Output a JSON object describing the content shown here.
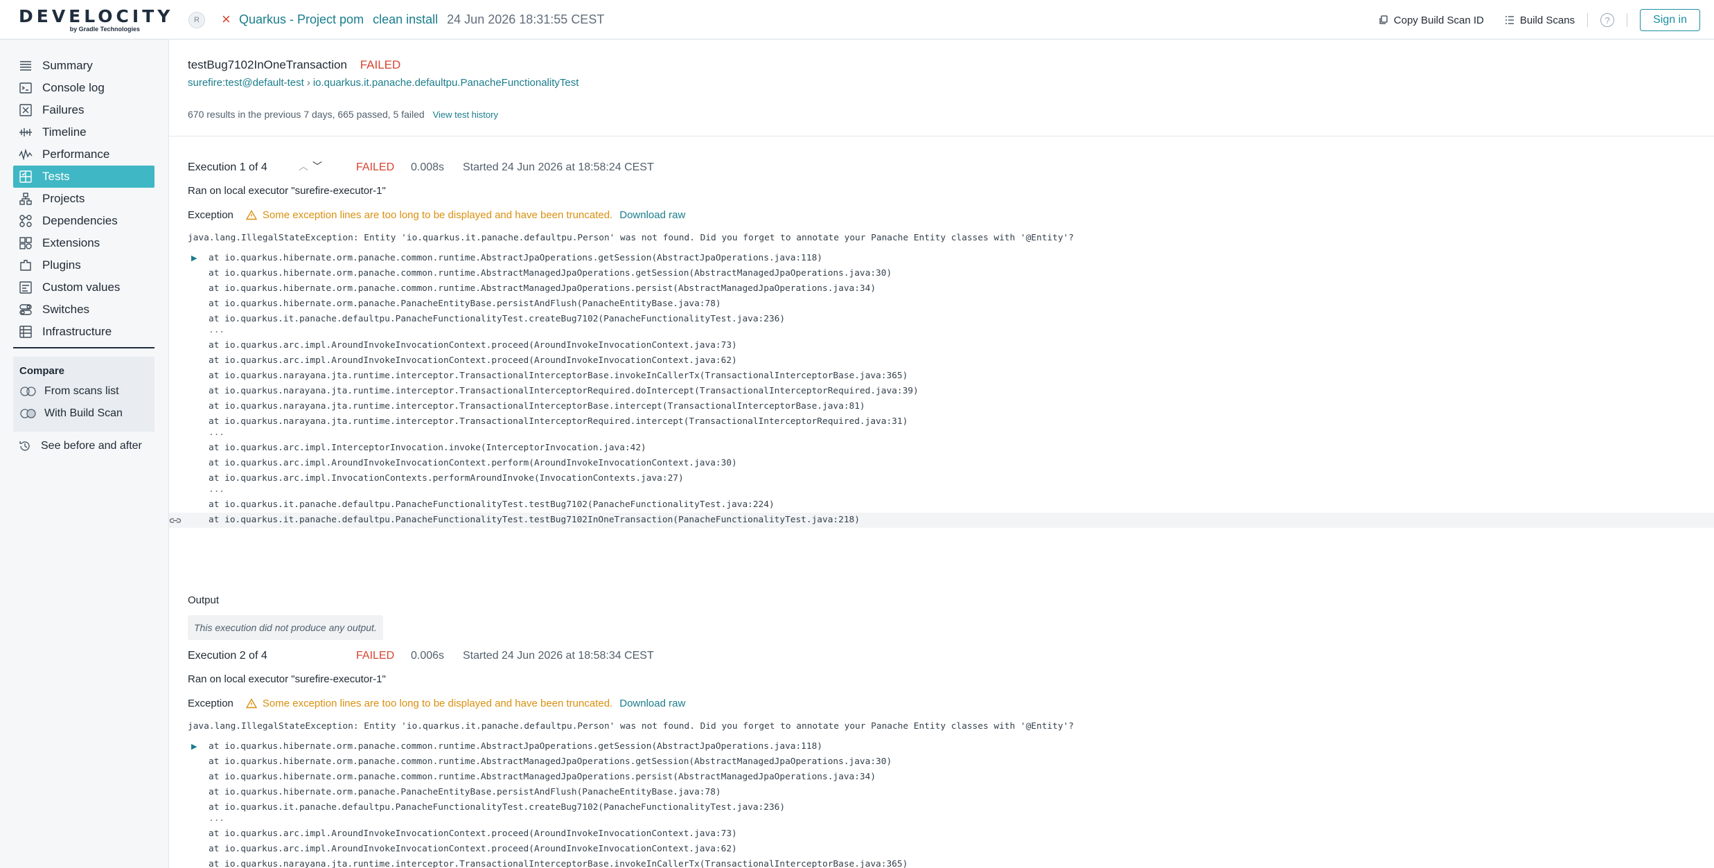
{
  "header": {
    "logo_word": "DEVELOCITY",
    "logo_sub": "by Gradle Technologies",
    "avatar_initial": "R",
    "status_mark": "×",
    "project": "Quarkus - Project pom",
    "task": "clean install",
    "date": "24 Jun 2026 18:31:55 CEST",
    "copy_id_label": "Copy Build Scan ID",
    "build_scans_label": "Build Scans",
    "help_label": "?",
    "signin_label": "Sign in"
  },
  "sidebar": {
    "items": [
      {
        "label": "Summary",
        "icon": "summary-icon"
      },
      {
        "label": "Console log",
        "icon": "console-icon"
      },
      {
        "label": "Failures",
        "icon": "failures-icon"
      },
      {
        "label": "Timeline",
        "icon": "timeline-icon"
      },
      {
        "label": "Performance",
        "icon": "performance-icon"
      },
      {
        "label": "Tests",
        "icon": "tests-icon",
        "active": true
      },
      {
        "label": "Projects",
        "icon": "projects-icon"
      },
      {
        "label": "Dependencies",
        "icon": "dependencies-icon"
      },
      {
        "label": "Extensions",
        "icon": "extensions-icon"
      },
      {
        "label": "Plugins",
        "icon": "plugins-icon"
      },
      {
        "label": "Custom values",
        "icon": "custom-values-icon"
      },
      {
        "label": "Switches",
        "icon": "switches-icon"
      },
      {
        "label": "Infrastructure",
        "icon": "infrastructure-icon"
      }
    ],
    "compare": {
      "title": "Compare",
      "from_scans": "From scans list",
      "with_scan": "With Build Scan"
    },
    "see_before_after": "See before and after"
  },
  "test": {
    "name": "testBug7102InOneTransaction",
    "status": "FAILED",
    "crumb_task": "surefire:test@default-test",
    "crumb_class": "io.quarkus.it.panache.defaultpu.PanacheFunctionalityTest",
    "results_summary": "670 results in the previous 7 days, 665 passed, 5 failed",
    "history_link": "View test history"
  },
  "executions": [
    {
      "title": "Execution 1 of 4",
      "status": "FAILED",
      "duration": "0.008s",
      "started": "Started 24 Jun 2026 at 18:58:24 CEST",
      "executor": "Ran on local executor \"surefire-executor-1\"",
      "exception_label": "Exception",
      "warning": "Some exception lines are too long to be displayed and have been truncated.",
      "download": "Download raw",
      "message": "java.lang.IllegalStateException: Entity 'io.quarkus.it.panache.defaultpu.Person' was not found. Did you forget to annotate your Panache Entity classes with '@Entity'?",
      "trace": [
        "at io.quarkus.hibernate.orm.panache.common.runtime.AbstractJpaOperations.getSession(AbstractJpaOperations.java:118)",
        "at io.quarkus.hibernate.orm.panache.common.runtime.AbstractManagedJpaOperations.getSession(AbstractManagedJpaOperations.java:30)",
        "at io.quarkus.hibernate.orm.panache.common.runtime.AbstractManagedJpaOperations.persist(AbstractManagedJpaOperations.java:34)",
        "at io.quarkus.hibernate.orm.panache.PanacheEntityBase.persistAndFlush(PanacheEntityBase.java:78)",
        "at io.quarkus.it.panache.defaultpu.PanacheFunctionalityTest.createBug7102(PanacheFunctionalityTest.java:236)",
        "...",
        "at io.quarkus.arc.impl.AroundInvokeInvocationContext.proceed(AroundInvokeInvocationContext.java:73)",
        "at io.quarkus.arc.impl.AroundInvokeInvocationContext.proceed(AroundInvokeInvocationContext.java:62)",
        "at io.quarkus.narayana.jta.runtime.interceptor.TransactionalInterceptorBase.invokeInCallerTx(TransactionalInterceptorBase.java:365)",
        "at io.quarkus.narayana.jta.runtime.interceptor.TransactionalInterceptorRequired.doIntercept(TransactionalInterceptorRequired.java:39)",
        "at io.quarkus.narayana.jta.runtime.interceptor.TransactionalInterceptorBase.intercept(TransactionalInterceptorBase.java:81)",
        "at io.quarkus.narayana.jta.runtime.interceptor.TransactionalInterceptorRequired.intercept(TransactionalInterceptorRequired.java:31)",
        "...",
        "at io.quarkus.arc.impl.InterceptorInvocation.invoke(InterceptorInvocation.java:42)",
        "at io.quarkus.arc.impl.AroundInvokeInvocationContext.perform(AroundInvokeInvocationContext.java:30)",
        "at io.quarkus.arc.impl.InvocationContexts.performAroundInvoke(InvocationContexts.java:27)",
        "...",
        "at io.quarkus.it.panache.defaultpu.PanacheFunctionalityTest.testBug7102(PanacheFunctionalityTest.java:224)",
        "at io.quarkus.it.panache.defaultpu.PanacheFunctionalityTest.testBug7102InOneTransaction(PanacheFunctionalityTest.java:218)"
      ],
      "output_label": "Output",
      "output_text": "This execution did not produce any output."
    },
    {
      "title": "Execution 2 of 4",
      "status": "FAILED",
      "duration": "0.006s",
      "started": "Started 24 Jun 2026 at 18:58:34 CEST",
      "executor": "Ran on local executor \"surefire-executor-1\"",
      "exception_label": "Exception",
      "warning": "Some exception lines are too long to be displayed and have been truncated.",
      "download": "Download raw",
      "message": "java.lang.IllegalStateException: Entity 'io.quarkus.it.panache.defaultpu.Person' was not found. Did you forget to annotate your Panache Entity classes with '@Entity'?",
      "trace": [
        "at io.quarkus.hibernate.orm.panache.common.runtime.AbstractJpaOperations.getSession(AbstractJpaOperations.java:118)",
        "at io.quarkus.hibernate.orm.panache.common.runtime.AbstractManagedJpaOperations.getSession(AbstractManagedJpaOperations.java:30)",
        "at io.quarkus.hibernate.orm.panache.common.runtime.AbstractManagedJpaOperations.persist(AbstractManagedJpaOperations.java:34)",
        "at io.quarkus.hibernate.orm.panache.PanacheEntityBase.persistAndFlush(PanacheEntityBase.java:78)",
        "at io.quarkus.it.panache.defaultpu.PanacheFunctionalityTest.createBug7102(PanacheFunctionalityTest.java:236)",
        "...",
        "at io.quarkus.arc.impl.AroundInvokeInvocationContext.proceed(AroundInvokeInvocationContext.java:73)",
        "at io.quarkus.arc.impl.AroundInvokeInvocationContext.proceed(AroundInvokeInvocationContext.java:62)",
        "at io.quarkus.narayana.jta.runtime.interceptor.TransactionalInterceptorBase.invokeInCallerTx(TransactionalInterceptorBase.java:365)"
      ]
    }
  ]
}
